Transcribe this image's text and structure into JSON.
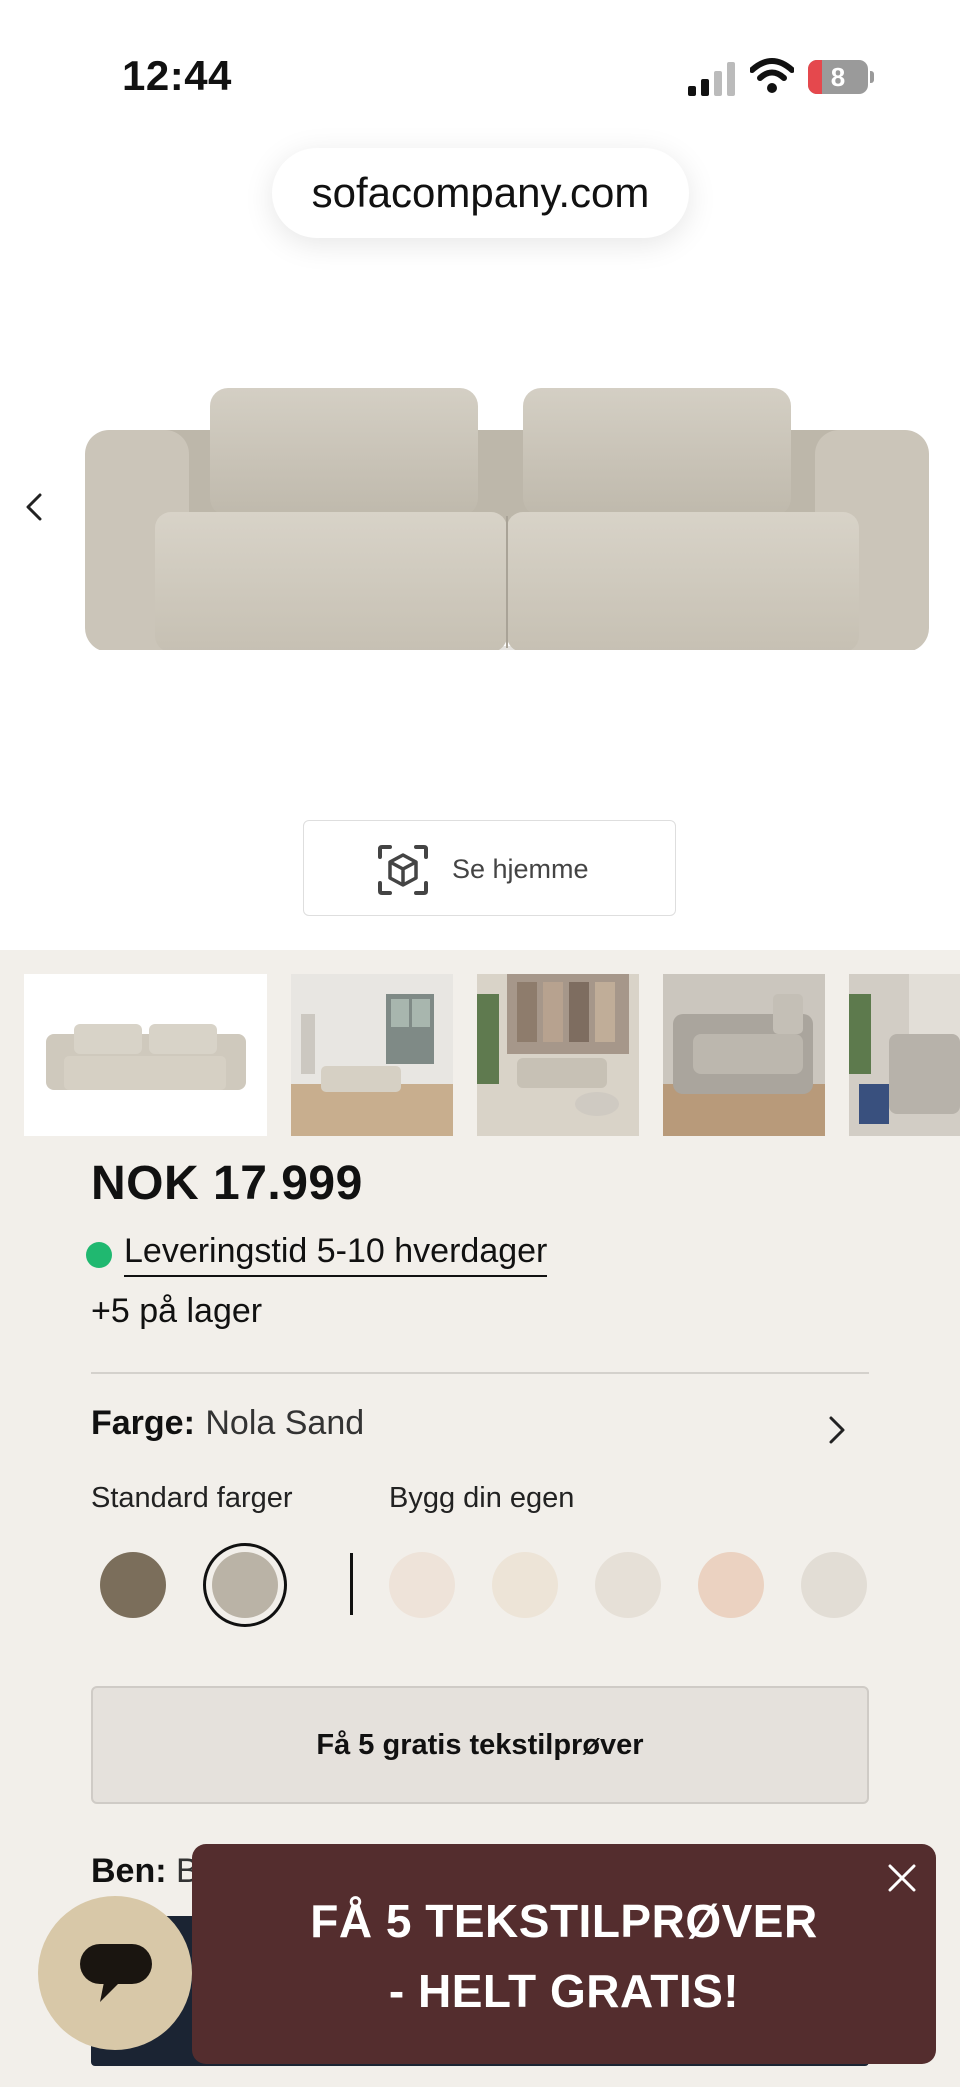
{
  "status_bar": {
    "time": "12:44",
    "battery_level": "8"
  },
  "browser": {
    "url": "sofacompany.com"
  },
  "hero": {
    "ar_button_label": "Se hjemme"
  },
  "product": {
    "price": "NOK 17.999",
    "delivery": "Leveringstid 5-10 hverdager",
    "stock": "+5 på lager",
    "color_key": "Farge:",
    "color_value": "Nola Sand",
    "standard_colors_label": "Standard farger",
    "custom_colors_label": "Bygg din egen",
    "standard_swatches": [
      "#7b6e5b",
      "#bab3a6"
    ],
    "custom_swatches": [
      "#eee3d9",
      "#ede4d7",
      "#e6e0d7",
      "#ebd2c1",
      "#e2ddd5"
    ],
    "samples_button": "Få 5 gratis tekstilprøver",
    "legs_key": "Ben:",
    "legs_value_partial": "B"
  },
  "promo": {
    "line1": "FÅ 5 TEKSTILPRØVER",
    "line2": "- HELT GRATIS!"
  },
  "colors": {
    "beige_bg": "#f2efea",
    "promo_bg": "#542d2e",
    "chat_bg": "#d8c8a8",
    "delivery_dot": "#20b870",
    "dark_button": "#1b2433"
  }
}
